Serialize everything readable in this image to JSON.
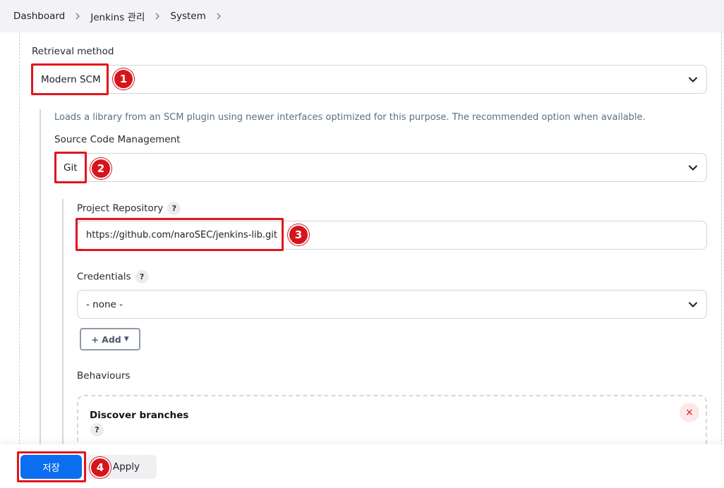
{
  "breadcrumb": {
    "items": [
      "Dashboard",
      "Jenkins 관리",
      "System"
    ]
  },
  "retrieval": {
    "label": "Retrieval method",
    "selected": "Modern SCM",
    "description": "Loads a library from an SCM plugin using newer interfaces optimized for this purpose. The recommended option when available."
  },
  "scm": {
    "label": "Source Code Management",
    "selected": "Git"
  },
  "repository": {
    "label": "Project Repository",
    "value": "https://github.com/naroSEC/jenkins-lib.git"
  },
  "credentials": {
    "label": "Credentials",
    "selected": "- none -",
    "add_label": "+ Add"
  },
  "behaviours": {
    "label": "Behaviours",
    "card_title": "Discover branches"
  },
  "help_glyph": "?",
  "close_glyph": "×",
  "annotations": [
    "1",
    "2",
    "3",
    "4"
  ],
  "footer": {
    "save_label": "저장",
    "apply_label": "Apply"
  },
  "colors": {
    "primary": "#0b6ef0",
    "annotation_red": "#e0151c",
    "description_text": "#5b6f86"
  }
}
